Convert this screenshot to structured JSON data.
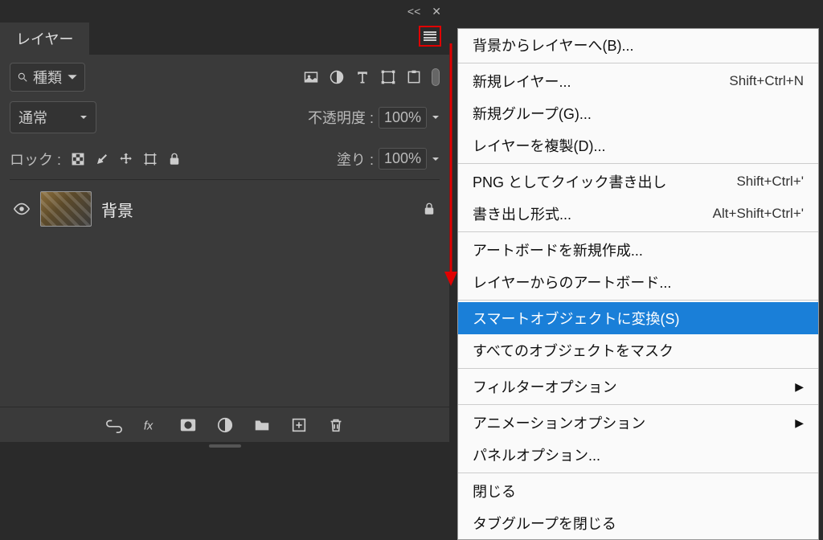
{
  "panel": {
    "collapse_symbol": "<<",
    "close_symbol": "✕",
    "tab_label": "レイヤー",
    "search_placeholder": "種類",
    "blend_mode": "通常",
    "opacity_label": "不透明度 :",
    "opacity_value": "100%",
    "lock_label": "ロック :",
    "fill_label": "塗り :",
    "fill_value": "100%",
    "layer": {
      "name": "背景"
    }
  },
  "menu": {
    "items": [
      {
        "label": "背景からレイヤーへ(B)..."
      },
      {
        "sep": true
      },
      {
        "label": "新規レイヤー...",
        "shortcut": "Shift+Ctrl+N"
      },
      {
        "label": "新規グループ(G)..."
      },
      {
        "label": "レイヤーを複製(D)..."
      },
      {
        "sep": true
      },
      {
        "label": "PNG としてクイック書き出し",
        "shortcut": "Shift+Ctrl+'"
      },
      {
        "label": "書き出し形式...",
        "shortcut": "Alt+Shift+Ctrl+'"
      },
      {
        "sep": true
      },
      {
        "label": "アートボードを新規作成..."
      },
      {
        "label": "レイヤーからのアートボード..."
      },
      {
        "sep": true
      },
      {
        "label": "スマートオブジェクトに変換(S)",
        "highlighted": true
      },
      {
        "label": "すべてのオブジェクトをマスク"
      },
      {
        "sep": true
      },
      {
        "label": "フィルターオプション",
        "submenu": true
      },
      {
        "sep": true
      },
      {
        "label": "アニメーションオプション",
        "submenu": true
      },
      {
        "label": "パネルオプション..."
      },
      {
        "sep": true
      },
      {
        "label": "閉じる"
      },
      {
        "label": "タブグループを閉じる"
      }
    ]
  }
}
